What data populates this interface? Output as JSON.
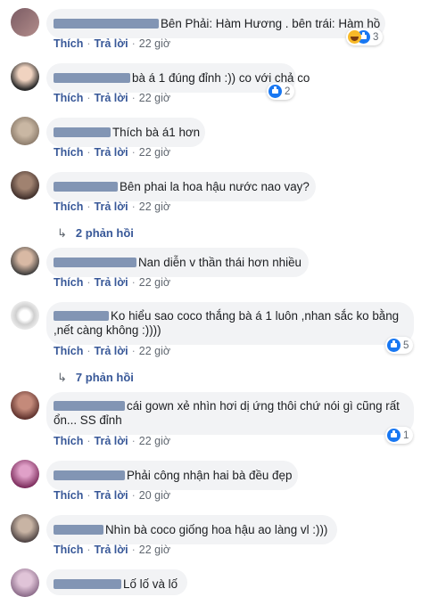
{
  "labels": {
    "like": "Thích",
    "reply": "Trả lời",
    "separator": "·"
  },
  "comments": [
    {
      "text": "Bên Phải: Hàm Hương . bên trái: Hàm hồ",
      "time": "22 giờ",
      "reaction_count": "3",
      "reactions": [
        "like-icon",
        "haha-icon"
      ]
    },
    {
      "text": "bà á 1 đúng đỉnh :)) co với chả co",
      "time": "22 giờ",
      "reaction_count": "2",
      "reactions": [
        "like-icon"
      ]
    },
    {
      "text": "Thích bà á1 hơn",
      "time": "22 giờ"
    },
    {
      "text": "Bên phai la hoa hậu nước nao vay?",
      "time": "22 giờ",
      "replies_label": "2 phản hồi"
    },
    {
      "text": "Nan diễn v thần thái hơn nhiều",
      "time": "22 giờ"
    },
    {
      "text_line1": "Ko hiểu sao coco thắng bà á 1 luôn ,nhan sắc ko bằng",
      "text_line2": ",nết càng không :))))",
      "time": "22 giờ",
      "reaction_count": "5",
      "reactions": [
        "like-icon"
      ],
      "replies_label": "7 phản hồi"
    },
    {
      "text_line1": "cái gown xẻ nhìn hơi dị ứng thôi chứ nói gì cũng rất",
      "text_line2": "ổn... SS đỉnh",
      "time": "22 giờ",
      "reaction_count": "1",
      "reactions": [
        "like-icon"
      ]
    },
    {
      "text": "Phải công nhận hai bà đều đẹp",
      "time": "20 giờ"
    },
    {
      "text": "Nhìn bà coco giống hoa hậu ao làng vl :)))",
      "time": "22 giờ"
    },
    {
      "text": "Lố lố và lố"
    }
  ],
  "colors": {
    "bubble": "#f2f3f5",
    "link": "#385898",
    "meta": "#606770",
    "like": "#1877f2",
    "redact": "#6e84a8"
  }
}
